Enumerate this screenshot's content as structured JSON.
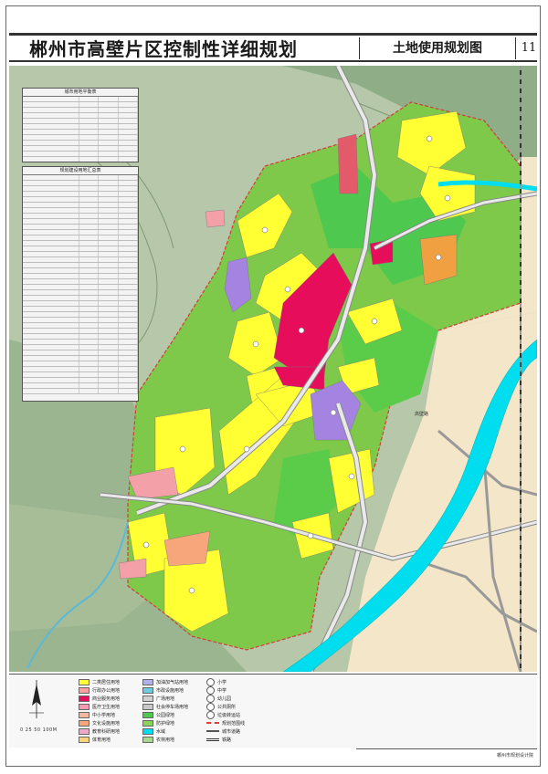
{
  "title": {
    "main": "郴州市高壁片区控制性详细规划",
    "sub": "土地使用规划图",
    "sheet_number": "11"
  },
  "tables": {
    "balance": {
      "title": "城市用地平衡表"
    },
    "land_use": {
      "title": "规划建设用地汇总表"
    }
  },
  "map_labels": {
    "road_label": "高壁路"
  },
  "scale_bar": "0  25  50     100M",
  "legend": [
    {
      "label": "二类居住用地",
      "color": "#ffff33",
      "kind": "swatch"
    },
    {
      "label": "行政办公用地",
      "color": "#ff9f9f",
      "kind": "swatch"
    },
    {
      "label": "商业服务用地",
      "color": "#e60d5a",
      "kind": "swatch"
    },
    {
      "label": "医疗卫生用地",
      "color": "#f59ab0",
      "kind": "swatch"
    },
    {
      "label": "中小学用地",
      "color": "#f3b8a0",
      "kind": "swatch"
    },
    {
      "label": "文化设施用地",
      "color": "#f7a57a",
      "kind": "swatch"
    },
    {
      "label": "教育科研用地",
      "color": "#f0a8c8",
      "kind": "swatch"
    },
    {
      "label": "体育用地",
      "color": "#fbd37a",
      "kind": "swatch"
    },
    {
      "label": "加油加气站用地",
      "color": "#b0b0f0",
      "kind": "swatch"
    },
    {
      "label": "市政设施用地",
      "color": "#6ecbe0",
      "kind": "swatch"
    },
    {
      "label": "广场用地",
      "color": "#d0d0d0",
      "kind": "swatch"
    },
    {
      "label": "社会停车场用地",
      "color": "#c8c8c8",
      "kind": "swatch"
    },
    {
      "label": "公园绿地",
      "color": "#4ec84e",
      "kind": "swatch"
    },
    {
      "label": "防护绿地",
      "color": "#8ad25a",
      "kind": "swatch"
    },
    {
      "label": "水域",
      "color": "#00ddee",
      "kind": "swatch"
    },
    {
      "label": "农林用地",
      "color": "#a8d890",
      "kind": "swatch"
    },
    {
      "label": "小学",
      "color": "#ffffff",
      "kind": "circle"
    },
    {
      "label": "中学",
      "color": "#ffffff",
      "kind": "circle"
    },
    {
      "label": "幼儿园",
      "color": "#ffffff",
      "kind": "circle"
    },
    {
      "label": "公共厕所",
      "color": "#ffffff",
      "kind": "circle"
    },
    {
      "label": "垃圾转运站",
      "color": "#ffffff",
      "kind": "circle"
    },
    {
      "label": "规划范围线",
      "color": "#e03c3c",
      "kind": "line-dash"
    },
    {
      "label": "城市道路",
      "color": "#555555",
      "kind": "line"
    },
    {
      "label": "铁路",
      "color": "#333333",
      "kind": "line-rail"
    }
  ],
  "footer": "郴州市规划设计院"
}
